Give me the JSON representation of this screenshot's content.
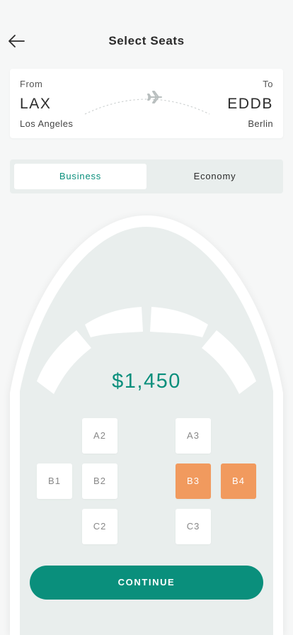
{
  "header": {
    "title": "Select Seats"
  },
  "route": {
    "from_label": "From",
    "from_code": "LAX",
    "from_city": "Los Angeles",
    "to_label": "To",
    "to_code": "EDDB",
    "to_city": "Berlin"
  },
  "tabs": [
    {
      "label": "Business",
      "active": true
    },
    {
      "label": "Economy",
      "active": false
    }
  ],
  "price": "$1,450",
  "seats": {
    "A2": {
      "label": "A2",
      "selected": false
    },
    "A3": {
      "label": "A3",
      "selected": false
    },
    "B1": {
      "label": "B1",
      "selected": false
    },
    "B2": {
      "label": "B2",
      "selected": false
    },
    "B3": {
      "label": "B3",
      "selected": true
    },
    "B4": {
      "label": "B4",
      "selected": true
    },
    "C2": {
      "label": "C2",
      "selected": false
    },
    "C3": {
      "label": "C3",
      "selected": false
    }
  },
  "continue_label": "CONTINUE",
  "colors": {
    "accent": "#0a8f7c",
    "selected_seat": "#f19a5e",
    "background": "#f6f7f7",
    "fuselage": "#e9eeed"
  },
  "icons": {
    "back": "arrow-left-icon",
    "flight": "airplane-icon"
  }
}
